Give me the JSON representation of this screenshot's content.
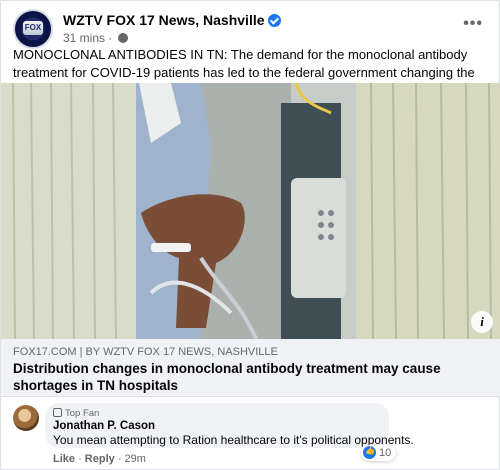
{
  "post": {
    "page_name": "WZTV FOX 17 News, Nashville",
    "avatar_text": "FOX",
    "timestamp": "31 mins · ",
    "text": "MONOCLONAL ANTIBODIES IN TN: The demand for the monoclonal antibody treatment for COVID-19 patients has led to the federal government changing the way it allocates its supply."
  },
  "link": {
    "domain": "FOX17.COM | BY WZTV FOX 17 NEWS, NASHVILLE",
    "title": "Distribution changes in monoclonal antibody treatment may cause shortages in TN hospitals",
    "info_label": "i"
  },
  "comment": {
    "badge": "Top Fan",
    "author": "Jonathan P. Cason",
    "text": "You mean attempting to Ration healthcare to it's political opponents.",
    "reaction_count": "10",
    "like_label": "Like",
    "separator": " · ",
    "reply_label": "Reply",
    "time": "29m"
  },
  "colors": {
    "accent": "#1877f2",
    "secondary_text": "#65676b",
    "link_meta_bg": "#f0f2f5"
  }
}
